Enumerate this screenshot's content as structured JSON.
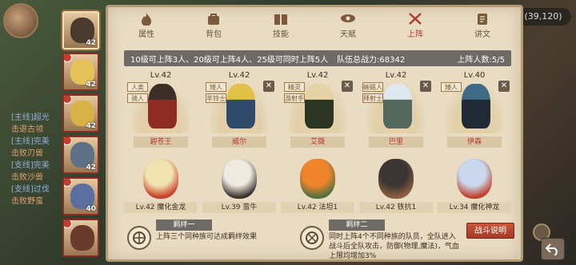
{
  "topbar": {
    "coords": "(39,120)"
  },
  "chat_lines": [
    {
      "text": "[主线]超光",
      "kind": "sys"
    },
    {
      "text": "击退古领",
      "kind": "hl"
    },
    {
      "text": "[主线]完美",
      "kind": "sys"
    },
    {
      "text": "击败刃兽",
      "kind": "hl"
    },
    {
      "text": "[支线]完美",
      "kind": "sys"
    },
    {
      "text": "击败沙兽",
      "kind": "hl"
    },
    {
      "text": "[支线]过伐",
      "kind": "sys"
    },
    {
      "text": "击败野蛮",
      "kind": "hl"
    }
  ],
  "roster": [
    {
      "lv": "42",
      "active": true,
      "color": "#4b3a2e",
      "badge": false
    },
    {
      "lv": "42",
      "active": false,
      "color": "#e6c15a",
      "badge": true
    },
    {
      "lv": "42",
      "active": false,
      "color": "#d9b247",
      "badge": true
    },
    {
      "lv": "42",
      "active": false,
      "color": "#5d7085",
      "badge": true
    },
    {
      "lv": "40",
      "active": false,
      "color": "#5a6fa0",
      "badge": true
    },
    {
      "lv": "",
      "active": false,
      "color": "#6a3b2d",
      "badge": true
    }
  ],
  "tabs": [
    {
      "label": "属性",
      "icon": "flame-icon",
      "active": false
    },
    {
      "label": "背包",
      "icon": "bag-icon",
      "active": false
    },
    {
      "label": "技能",
      "icon": "book-icon",
      "active": false
    },
    {
      "label": "天赋",
      "icon": "eye-icon",
      "active": false
    },
    {
      "label": "上阵",
      "icon": "crossed-swords-icon",
      "active": true
    },
    {
      "label": "讲文",
      "icon": "scroll-icon",
      "active": false
    }
  ],
  "info": {
    "rule": "10级可上阵3人、20级可上阵4人、25级可同时上阵5人",
    "power": "队伍总战力:68342",
    "count": "上阵人数:5/5"
  },
  "heroes": [
    {
      "level": "Lv.42",
      "tags": [
        "人类",
        "骑人"
      ],
      "name": "碧苍王",
      "colors": [
        "#3c2f28",
        "#8e2b23"
      ],
      "close": false
    },
    {
      "level": "Lv.42",
      "tags": [
        "矮人",
        "羊铃士"
      ],
      "name": "威尔",
      "colors": [
        "#e2c04a",
        "#2f4a6b"
      ],
      "close": true
    },
    {
      "level": "Lv.42",
      "tags": [
        "精灵",
        "游射手"
      ],
      "name": "艾薇",
      "colors": [
        "#e6d3a5",
        "#2b3323"
      ],
      "close": true
    },
    {
      "level": "Lv.42",
      "tags": [
        "蜥蜴人",
        "拜射士"
      ],
      "name": "巴里",
      "colors": [
        "#dde8ef",
        "#53685f"
      ],
      "close": true
    },
    {
      "level": "Lv.40",
      "tags": [
        "矮人"
      ],
      "name": "伊森",
      "colors": [
        "#3e6a86",
        "#1f2a34"
      ],
      "close": true
    }
  ],
  "beasts": [
    {
      "label": "Lv.42 魔化金龙",
      "colors": [
        "#f1e3b0",
        "#c8412a"
      ]
    },
    {
      "label": "Lv.39 蛮牛",
      "colors": [
        "#efe9df",
        "#3c3332"
      ]
    },
    {
      "label": "Lv.42 法坦1",
      "colors": [
        "#f0842d",
        "#53723b"
      ]
    },
    {
      "label": "Lv.42 铁抗1",
      "colors": [
        "#3b3533",
        "#8c5d40"
      ]
    },
    {
      "label": "Lv.34 魔化神龙",
      "colors": [
        "#c9d8ee",
        "#c2412d"
      ]
    }
  ],
  "bond1": {
    "title": "羁绊一",
    "text": "上阵三个同种族可达成羁绊效果"
  },
  "bond2": {
    "title": "羁绊二",
    "text_lines": [
      "同时上阵4个不同种族的队员，全队进入",
      "战斗后全队攻击，防御(物理,魔法)，气血",
      "上限均增加3%"
    ]
  },
  "fight_label": "战斗说明"
}
